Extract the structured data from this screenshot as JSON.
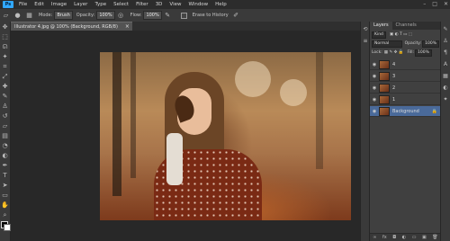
{
  "menubar": {
    "app_logo": "Ps",
    "items": [
      "File",
      "Edit",
      "Image",
      "Layer",
      "Type",
      "Select",
      "Filter",
      "3D",
      "View",
      "Window",
      "Help"
    ],
    "window_controls": [
      "–",
      "□",
      "✕"
    ]
  },
  "options": {
    "mode_label": "Mode:",
    "mode_value": "Brush",
    "opacity_label": "Opacity:",
    "opacity_value": "100%",
    "flow_label": "Flow:",
    "flow_value": "100%",
    "erase_history_label": "Erase to History"
  },
  "document": {
    "tab_title": "Illustrator 4.jpg @ 100% (Background, RGB/8)",
    "close_glyph": "×"
  },
  "layers_panel": {
    "tabs": [
      "Layers",
      "Channels"
    ],
    "kind_label": "Kind",
    "blend_mode": "Normal",
    "opacity_label": "Opacity:",
    "opacity_value": "100%",
    "lock_label": "Lock:",
    "fill_label": "Fill:",
    "fill_value": "100%",
    "layers": [
      {
        "name": "4",
        "selected": false,
        "locked": false
      },
      {
        "name": "3",
        "selected": false,
        "locked": false
      },
      {
        "name": "2",
        "selected": false,
        "locked": false
      },
      {
        "name": "1",
        "selected": false,
        "locked": false
      },
      {
        "name": "Background",
        "selected": true,
        "locked": true
      }
    ]
  },
  "colors": {
    "accent": "#31A8FF",
    "selected_layer": "#4a6a9a",
    "foreground": "#000000",
    "background": "#ffffff"
  }
}
